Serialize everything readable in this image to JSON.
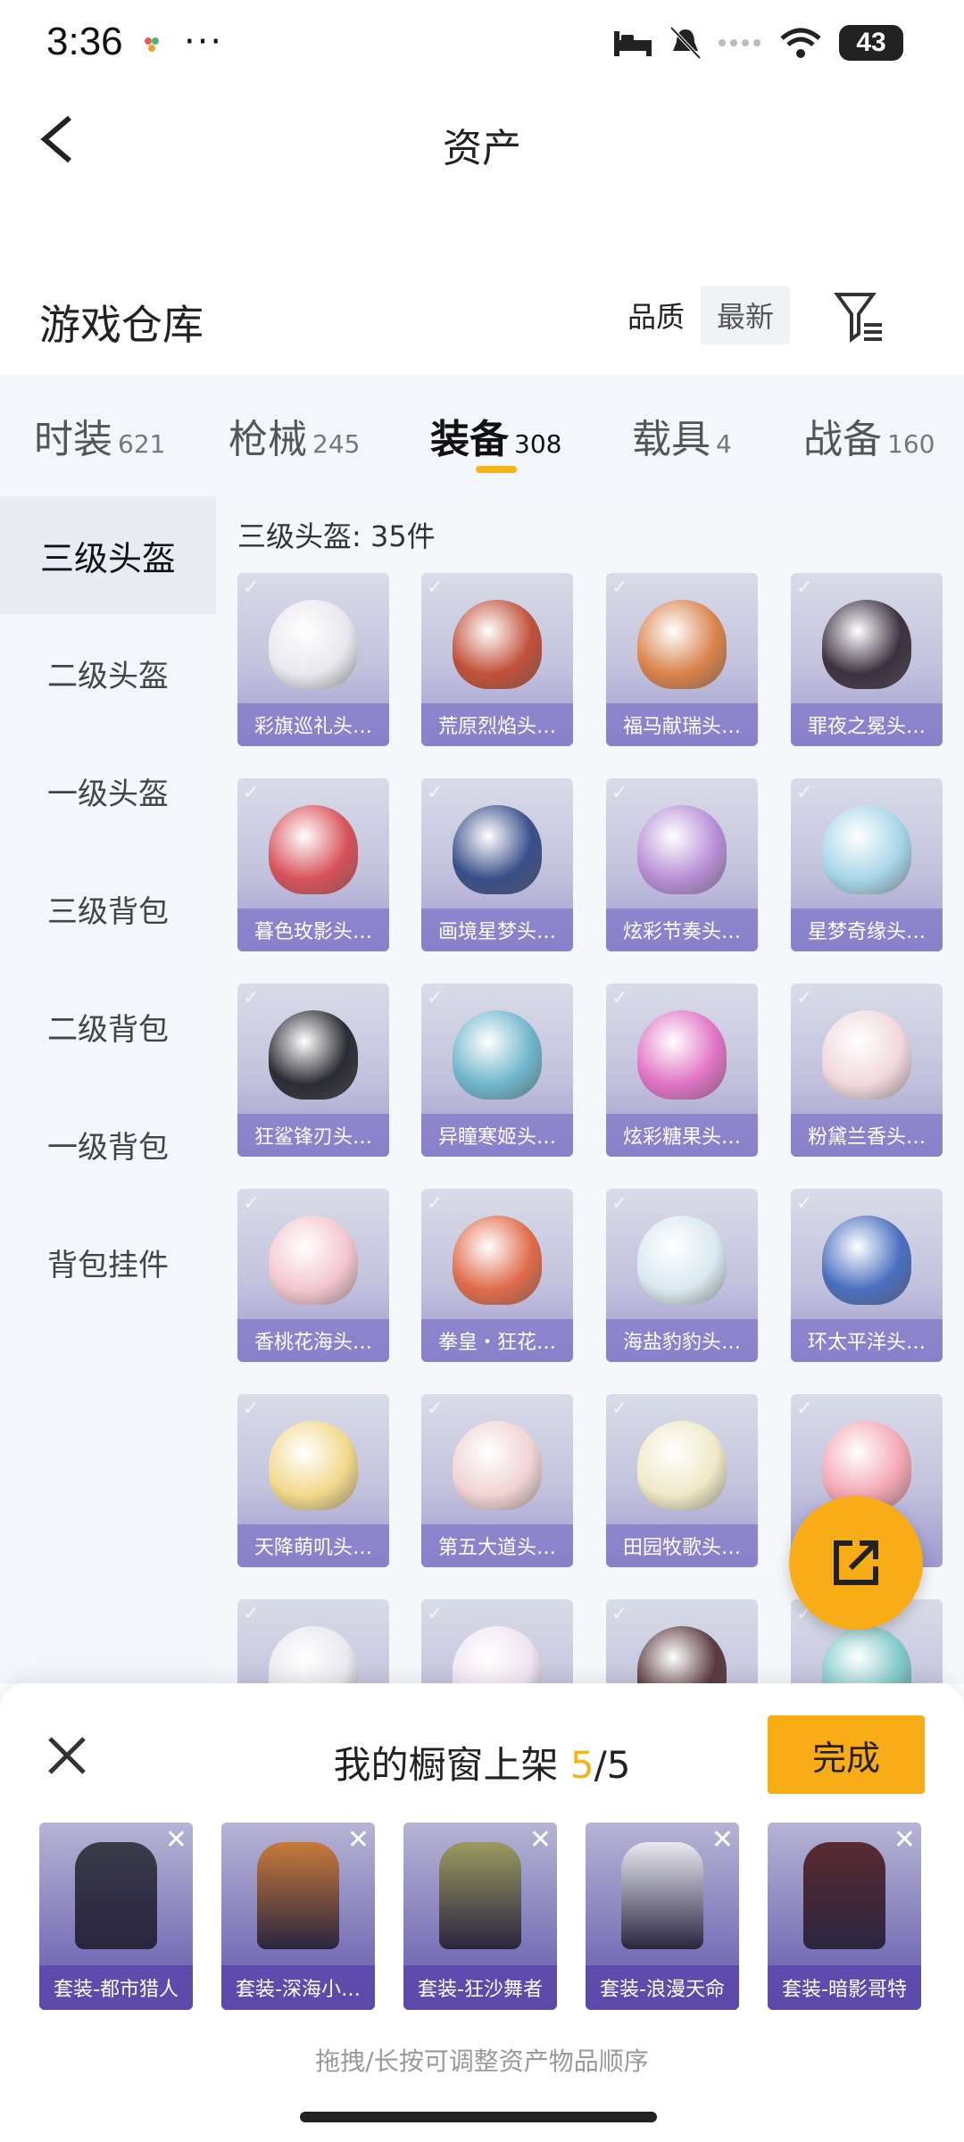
{
  "status": {
    "time": "3:36",
    "more": "···",
    "battery": "43"
  },
  "header": {
    "title": "资产"
  },
  "warehouse": {
    "title": "游戏仓库",
    "sort_options": [
      "品质",
      "最新"
    ]
  },
  "tabs": [
    {
      "label": "时装",
      "count": "621"
    },
    {
      "label": "枪械",
      "count": "245"
    },
    {
      "label": "装备",
      "count": "308"
    },
    {
      "label": "载具",
      "count": "4"
    },
    {
      "label": "战备",
      "count": "160"
    }
  ],
  "sidebar": [
    "三级头盔",
    "二级头盔",
    "一级头盔",
    "三级背包",
    "二级背包",
    "一级背包",
    "背包挂件"
  ],
  "content": {
    "count_label": "三级头盔: 35件"
  },
  "items": [
    {
      "name": "彩旗巡礼头…",
      "color": "#e8e8ee"
    },
    {
      "name": "荒原烈焰头…",
      "color": "#c2503a"
    },
    {
      "name": "福马献瑞头…",
      "color": "#d9834a"
    },
    {
      "name": "罪夜之冕头…",
      "color": "#3c3140"
    },
    {
      "name": "暮色玫影头…",
      "color": "#d8525a"
    },
    {
      "name": "画境星梦头…",
      "color": "#3a4f8a"
    },
    {
      "name": "炫彩节奏头…",
      "color": "#b78fd6"
    },
    {
      "name": "星梦奇缘头…",
      "color": "#a8d6e8"
    },
    {
      "name": "狂鲨锋刃头…",
      "color": "#2b2b33"
    },
    {
      "name": "异瞳寒姬头…",
      "color": "#6fb6cc"
    },
    {
      "name": "炫彩糖果头…",
      "color": "#e073c5"
    },
    {
      "name": "粉黛兰香头…",
      "color": "#f0d8dd"
    },
    {
      "name": "香桃花海头…",
      "color": "#f3c6cf"
    },
    {
      "name": "拳皇・狂花…",
      "color": "#e06b4a"
    },
    {
      "name": "海盐豹豹头…",
      "color": "#d9e8f0"
    },
    {
      "name": "环太平洋头…",
      "color": "#4a6fbf"
    },
    {
      "name": "天降萌叽头…",
      "color": "#f2d98b"
    },
    {
      "name": "第五大道头…",
      "color": "#f1d3d3"
    },
    {
      "name": "田园牧歌头…",
      "color": "#efe9c7"
    },
    {
      "name": "",
      "color": "#f3a8b4"
    },
    {
      "name": "",
      "color": "#e8e8ee"
    },
    {
      "name": "",
      "color": "#f0e4f0"
    },
    {
      "name": "",
      "color": "#5a3a40"
    },
    {
      "name": "",
      "color": "#7fc9c9"
    }
  ],
  "sheet": {
    "title_prefix": "我的橱窗上架",
    "count_current": "5",
    "count_total": "/5",
    "done_label": "完成",
    "hint": "拖拽/长按可调整资产物品顺序",
    "slots": [
      {
        "name": "套装-都市猎人",
        "color": "#3a3a48"
      },
      {
        "name": "套装-深海小…",
        "color": "#c87a3a"
      },
      {
        "name": "套装-狂沙舞者",
        "color": "#9a9a60"
      },
      {
        "name": "套装-浪漫天命",
        "color": "#e9e9f2"
      },
      {
        "name": "套装-暗影哥特",
        "color": "#5a2a30"
      }
    ]
  },
  "colors": {
    "accent": "#f8ac16",
    "highlight": "#f6b317"
  }
}
